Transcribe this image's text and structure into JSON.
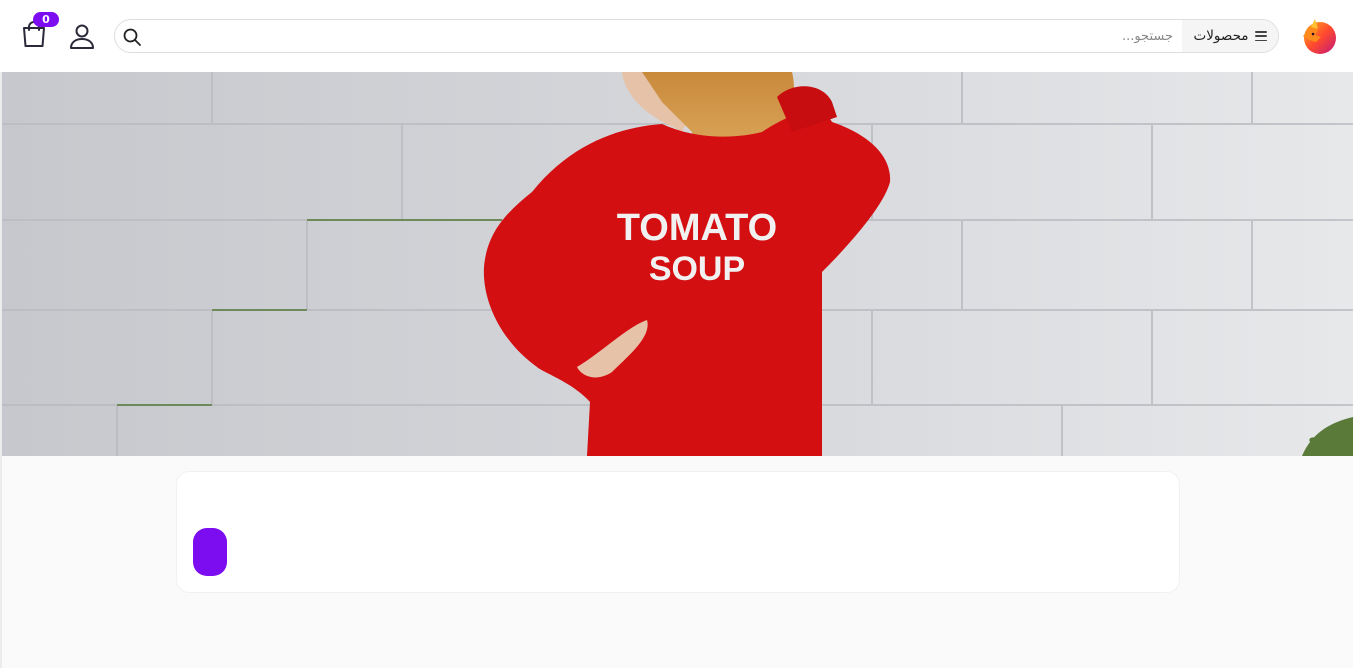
{
  "header": {
    "cart": {
      "icon": "shopping-bag-icon",
      "count": "0"
    },
    "account": {
      "icon": "user-icon"
    },
    "search": {
      "placeholder": "جستجو...",
      "value": "",
      "icon": "search-icon",
      "category_label": "محصولات",
      "category_icon": "menu-icon"
    },
    "logo": {
      "icon": "fox-logo-icon"
    }
  },
  "hero": {
    "image": "woman-red-sweatshirt-photo",
    "shirt_text_line1": "TOMATO",
    "shirt_text_line2": "SOUP"
  },
  "content": {
    "card": {
      "button": {
        "icon": "purple-pill",
        "color": "#7b0df0"
      }
    }
  },
  "colors": {
    "accent": "#7b0df0",
    "background": "#fafafa",
    "header_bg": "#ffffff",
    "shirt_red": "#d40f12"
  }
}
